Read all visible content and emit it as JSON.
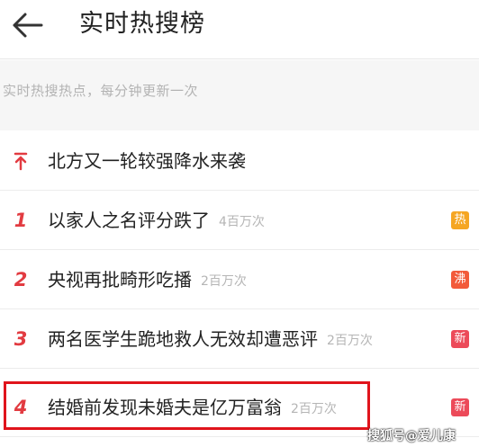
{
  "header": {
    "title": "实时热搜榜",
    "back_icon": "arrow-left-icon"
  },
  "subheader": {
    "text": "实时热搜热点，每分钟更新一次"
  },
  "colors": {
    "accent": "#e23b41",
    "badge_hot": "#f5a623",
    "badge_boil": "#f25a3a",
    "badge_new": "#ec4a59"
  },
  "list": [
    {
      "rank": "↑",
      "topic": "北方又一轮较强降水来袭",
      "count": "",
      "badge": ""
    },
    {
      "rank": "1",
      "topic": "以家人之名评分跌了",
      "count": "4百万次",
      "badge": "热"
    },
    {
      "rank": "2",
      "topic": "央视再批畸形吃播",
      "count": "2百万次",
      "badge": "沸"
    },
    {
      "rank": "3",
      "topic": "两名医学生跪地救人无效却遭恶评",
      "count": "2百万次",
      "badge": "新"
    },
    {
      "rank": "4",
      "topic": "结婚前发现未婚夫是亿万富翁",
      "count": "2百万次",
      "badge": "新"
    }
  ],
  "watermark": "搜狐号@爱儿康"
}
